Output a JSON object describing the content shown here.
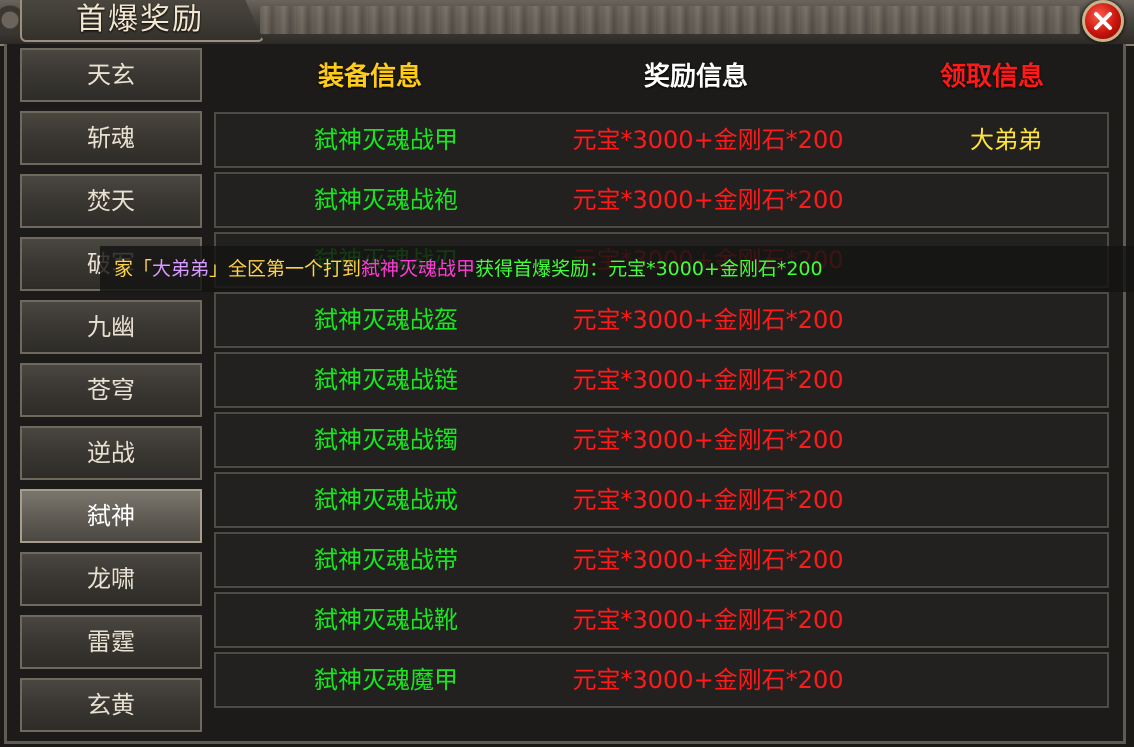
{
  "window": {
    "title": "首爆奖励",
    "close_icon": "close-icon"
  },
  "colors": {
    "equip": "#19e61f",
    "reward": "#ff1a1a",
    "claim": "#ffe23a",
    "header_equip": "#ffcc1a",
    "header_reward": "#ffffff",
    "header_claim": "#ff1a1a"
  },
  "sidebar": {
    "items": [
      {
        "label": "天玄"
      },
      {
        "label": "斩魂"
      },
      {
        "label": "焚天"
      },
      {
        "label": "破军"
      },
      {
        "label": "九幽"
      },
      {
        "label": "苍穹"
      },
      {
        "label": "逆战"
      },
      {
        "label": "弑神",
        "active": true
      },
      {
        "label": "龙啸"
      },
      {
        "label": "雷霆"
      },
      {
        "label": "玄黄"
      }
    ]
  },
  "table": {
    "headers": {
      "equip": "装备信息",
      "reward": "奖励信息",
      "claim": "领取信息"
    },
    "rows": [
      {
        "equip": "弑神灭魂战甲",
        "reward": "元宝*3000+金刚石*200",
        "claim": "大弟弟"
      },
      {
        "equip": "弑神灭魂战袍",
        "reward": "元宝*3000+金刚石*200",
        "claim": ""
      },
      {
        "equip": "弑神灭魂战刃",
        "reward": "元宝*3000+金刚石*200",
        "claim": ""
      },
      {
        "equip": "弑神灭魂战盔",
        "reward": "元宝*3000+金刚石*200",
        "claim": ""
      },
      {
        "equip": "弑神灭魂战链",
        "reward": "元宝*3000+金刚石*200",
        "claim": ""
      },
      {
        "equip": "弑神灭魂战镯",
        "reward": "元宝*3000+金刚石*200",
        "claim": ""
      },
      {
        "equip": "弑神灭魂战戒",
        "reward": "元宝*3000+金刚石*200",
        "claim": ""
      },
      {
        "equip": "弑神灭魂战带",
        "reward": "元宝*3000+金刚石*200",
        "claim": ""
      },
      {
        "equip": "弑神灭魂战靴",
        "reward": "元宝*3000+金刚石*200",
        "claim": ""
      },
      {
        "equip": "弑神灭魂魔甲",
        "reward": "元宝*3000+金刚石*200",
        "claim": ""
      }
    ]
  },
  "broadcast": {
    "prefix": "家「",
    "player": "大弟弟",
    "middle": "」全区第一个打到",
    "item": "弑神灭魂战甲",
    "suffix": "获得首爆奖励：元宝*3000+金刚石*200"
  }
}
